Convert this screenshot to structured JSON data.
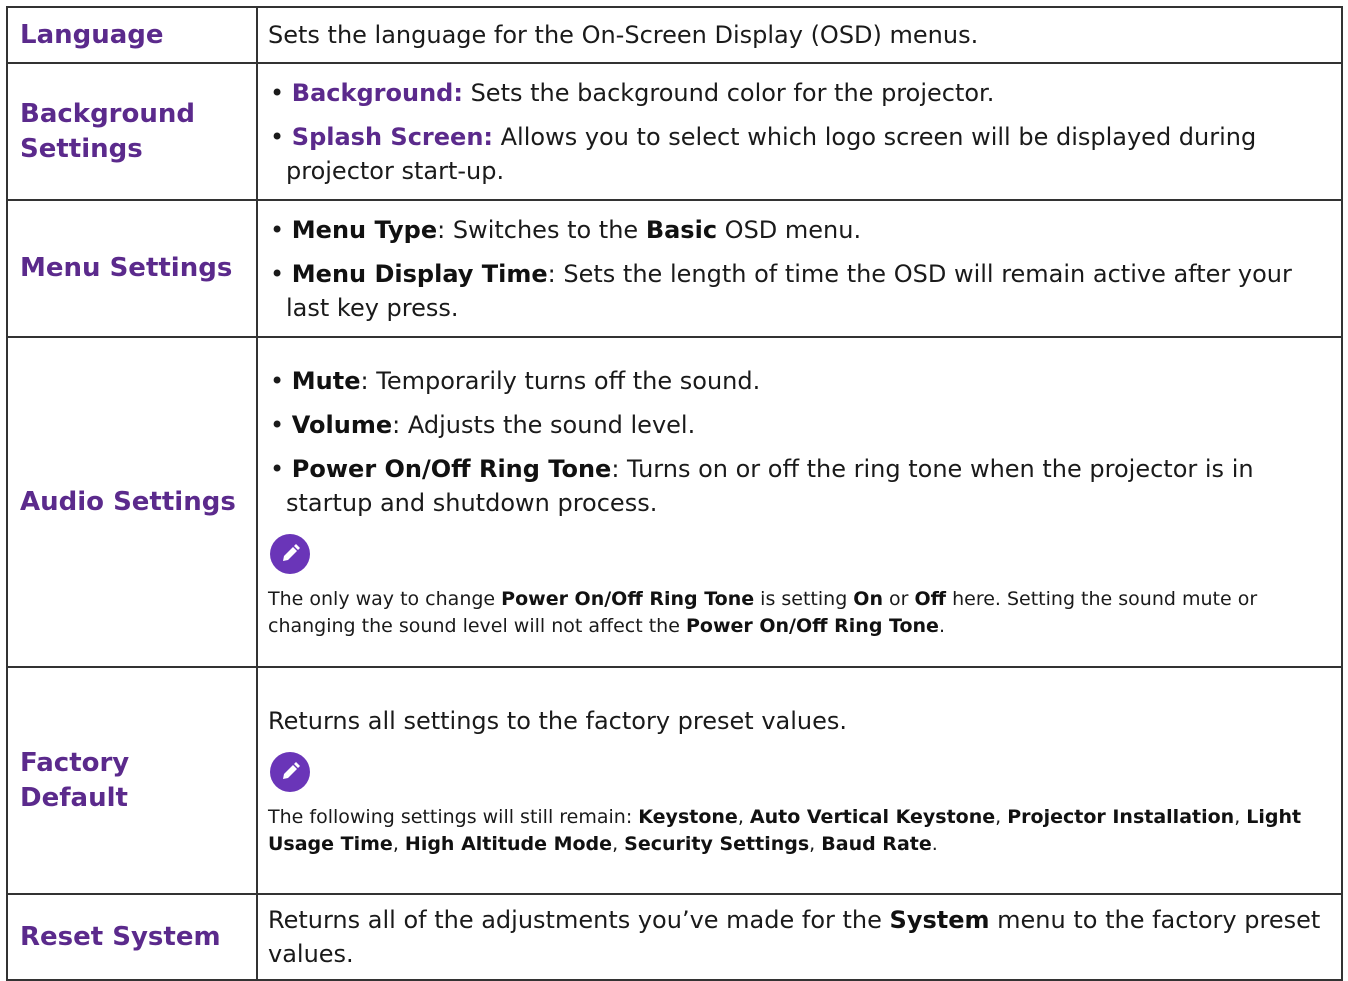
{
  "rows": [
    {
      "name": "Language",
      "text": "Sets the language for the On-Screen Display (OSD) menus."
    },
    {
      "name": "Background Settings",
      "bullets": [
        {
          "b": "Background:",
          "t": " Sets the background color for the projector."
        },
        {
          "b": "Splash Screen:",
          "t": " Allows you to select which logo screen will be displayed during projector start-up."
        }
      ]
    },
    {
      "name": "Menu Settings",
      "bullets": [
        {
          "b": "Menu Type",
          "t1": ": Switches to the ",
          "b2": "Basic",
          "t2": " OSD menu."
        },
        {
          "b": "Menu Display Time",
          "t": ": Sets the length of time the OSD will remain active after your last key press."
        }
      ]
    },
    {
      "name": "Audio Settings",
      "bullets": [
        {
          "b": "Mute",
          "t": ": Temporarily turns off the sound."
        },
        {
          "b": "Volume",
          "t": ": Adjusts the sound level."
        },
        {
          "b": "Power On/Off Ring Tone",
          "t": ": Turns on or off the ring tone when the projector is in startup and shutdown process."
        }
      ],
      "note": {
        "icon": "pencil-icon",
        "s1": "The only way to change ",
        "b1": "Power On/Off Ring Tone",
        "s2": " is setting ",
        "b2": "On",
        "s3": " or ",
        "b3": "Off",
        "s4": " here. Setting the sound mute or changing the sound level will not affect the ",
        "b4": "Power On/Off Ring Tone",
        "s5": "."
      }
    },
    {
      "name": "Factory Default",
      "text": "Returns all settings to the factory preset values.",
      "note": {
        "icon": "pencil-icon",
        "s1": "The following settings will still remain: ",
        "items": [
          "Keystone",
          "Auto Vertical Keystone",
          "Projector Installation",
          "Light Usage Time",
          "High Altitude Mode",
          "Security Settings",
          "Baud Rate"
        ],
        "sep": ", ",
        "end": "."
      }
    },
    {
      "name": "Reset System",
      "t1": "Returns all of the adjustments you’ve made for the ",
      "b": "System",
      "t2": " menu to the factory preset values."
    }
  ],
  "colors": {
    "heading": "#5b2a8c",
    "note_icon": "#6a35b8",
    "border": "#333333"
  }
}
